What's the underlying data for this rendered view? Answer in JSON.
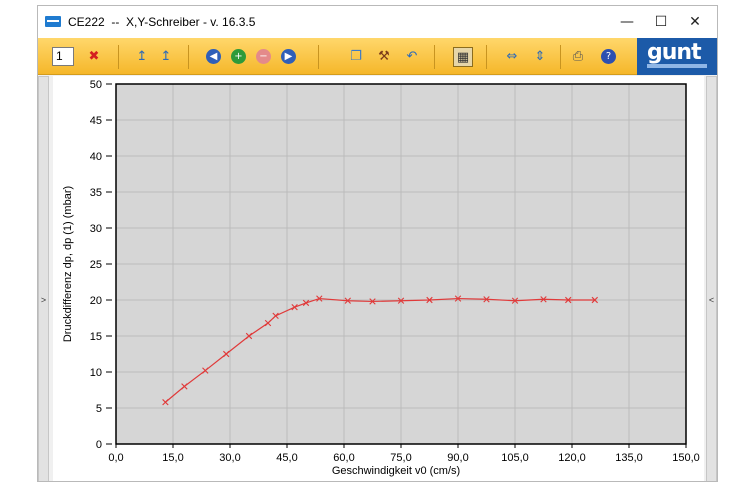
{
  "window": {
    "title": "CE222  --  X,Y-Schreiber - v. 16.3.5",
    "minimize_icon": "minimize-icon",
    "maximize_icon": "maximize-icon",
    "close_icon": "close-icon"
  },
  "toolbar": {
    "page_number": "1",
    "logo_text": "gunt",
    "icons": [
      "delete-icon",
      "export-icon",
      "import-icon",
      "previous-icon",
      "add-icon",
      "remove-icon",
      "next-icon",
      "copy-icon",
      "settings-icon",
      "undo-icon",
      "grid-icon",
      "fit-x-icon",
      "fit-y-icon",
      "print-icon",
      "help-icon"
    ],
    "colors": {
      "bar": "#f5b72a",
      "logo": "#1c5aa8"
    }
  },
  "side_handles": {
    "left": ">",
    "right": "<"
  },
  "chart_data": {
    "type": "line",
    "title": "",
    "xlabel": "Geschwindigkeit v0   (cm/s)",
    "ylabel": "Druckdifferenz  dp, dp (1)   (mbar)",
    "xlim": [
      0,
      150
    ],
    "ylim": [
      0,
      50
    ],
    "xticks": [
      "0,0",
      "15,0",
      "30,0",
      "45,0",
      "60,0",
      "75,0",
      "90,0",
      "105,0",
      "120,0",
      "135,0",
      "150,0"
    ],
    "yticks": [
      "0",
      "5",
      "10",
      "15",
      "20",
      "25",
      "30",
      "35",
      "40",
      "45",
      "50"
    ],
    "grid": true,
    "series": [
      {
        "color": "#e03a3a",
        "marker": "x",
        "x": [
          13.0,
          18.0,
          23.5,
          29.0,
          35.0,
          40.0,
          42.0,
          47.0,
          50.0,
          53.5,
          61.0,
          67.5,
          75.0,
          82.5,
          90.0,
          97.5,
          105.0,
          112.5,
          119.0,
          126.0
        ],
        "y": [
          5.8,
          8.0,
          10.2,
          12.5,
          15.0,
          16.8,
          17.8,
          19.0,
          19.6,
          20.2,
          19.9,
          19.8,
          19.9,
          20.0,
          20.2,
          20.1,
          19.9,
          20.1,
          20.0,
          20.0
        ]
      }
    ]
  }
}
